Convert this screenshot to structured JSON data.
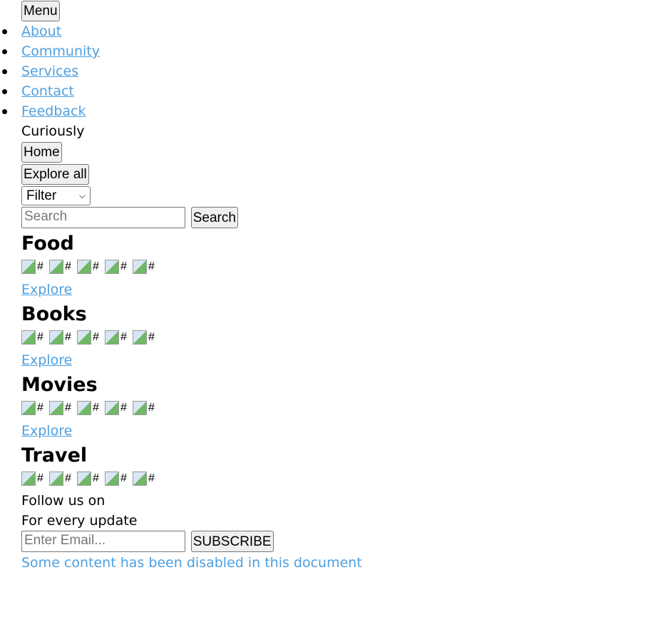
{
  "header": {
    "menu_label": "Menu"
  },
  "nav": {
    "items": [
      "About",
      "Community",
      "Services",
      "Contact",
      "Feedback"
    ]
  },
  "brand": "Curiously",
  "buttons": {
    "home": "Home",
    "explore_all": "Explore all"
  },
  "filter": {
    "selected": "Filter"
  },
  "search": {
    "placeholder": "Search",
    "button": "Search"
  },
  "sections": [
    {
      "title": "Food",
      "image_alt": [
        "#",
        "#",
        "#",
        "#",
        "#"
      ],
      "link": "Explore"
    },
    {
      "title": "Books",
      "image_alt": [
        "#",
        "#",
        "#",
        "#",
        "#"
      ],
      "link": "Explore"
    },
    {
      "title": "Movies",
      "image_alt": [
        "#",
        "#",
        "#",
        "#",
        "#"
      ],
      "link": "Explore"
    },
    {
      "title": "Travel",
      "image_alt": [
        "#",
        "#",
        "#",
        "#",
        "#"
      ]
    }
  ],
  "footer": {
    "follow": "Follow us on",
    "update": "For every update",
    "email_placeholder": "Enter Email...",
    "subscribe": "SUBSCRIBE",
    "notice": "Some content has been disabled in this document"
  },
  "colors": {
    "link": "#4d9fe0"
  }
}
